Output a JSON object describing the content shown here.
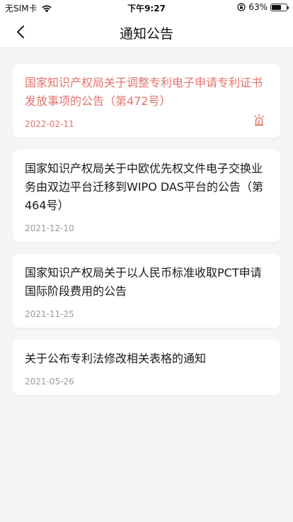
{
  "status_bar": {
    "carrier": "无SIM卡",
    "time": "下午9:27",
    "battery": "63%",
    "battery_level": 0.63
  },
  "nav": {
    "title": "通知公告",
    "back_icon": "chevron-left-icon"
  },
  "notices": [
    {
      "title": "国家知识产权局关于调整专利电子申请专利证书发放事项的公告（第472号）",
      "date": "2022-02-11",
      "highlight": true,
      "icon": "alarm-icon"
    },
    {
      "title": "国家知识产权局关于中欧优先权文件电子交换业务由双边平台迁移到WIPO DAS平台的公告（第464号）",
      "date": "2021-12-10",
      "highlight": false
    },
    {
      "title": "国家知识产权局关于以人民币标准收取PCT申请国际阶段费用的公告",
      "date": "2021-11-25",
      "highlight": false
    },
    {
      "title": "关于公布专利法修改相关表格的通知",
      "date": "2021-05-26",
      "highlight": false
    }
  ],
  "colors": {
    "highlight": "#e4736b",
    "background": "#f5f5f5",
    "card": "#ffffff",
    "date": "#999999"
  }
}
